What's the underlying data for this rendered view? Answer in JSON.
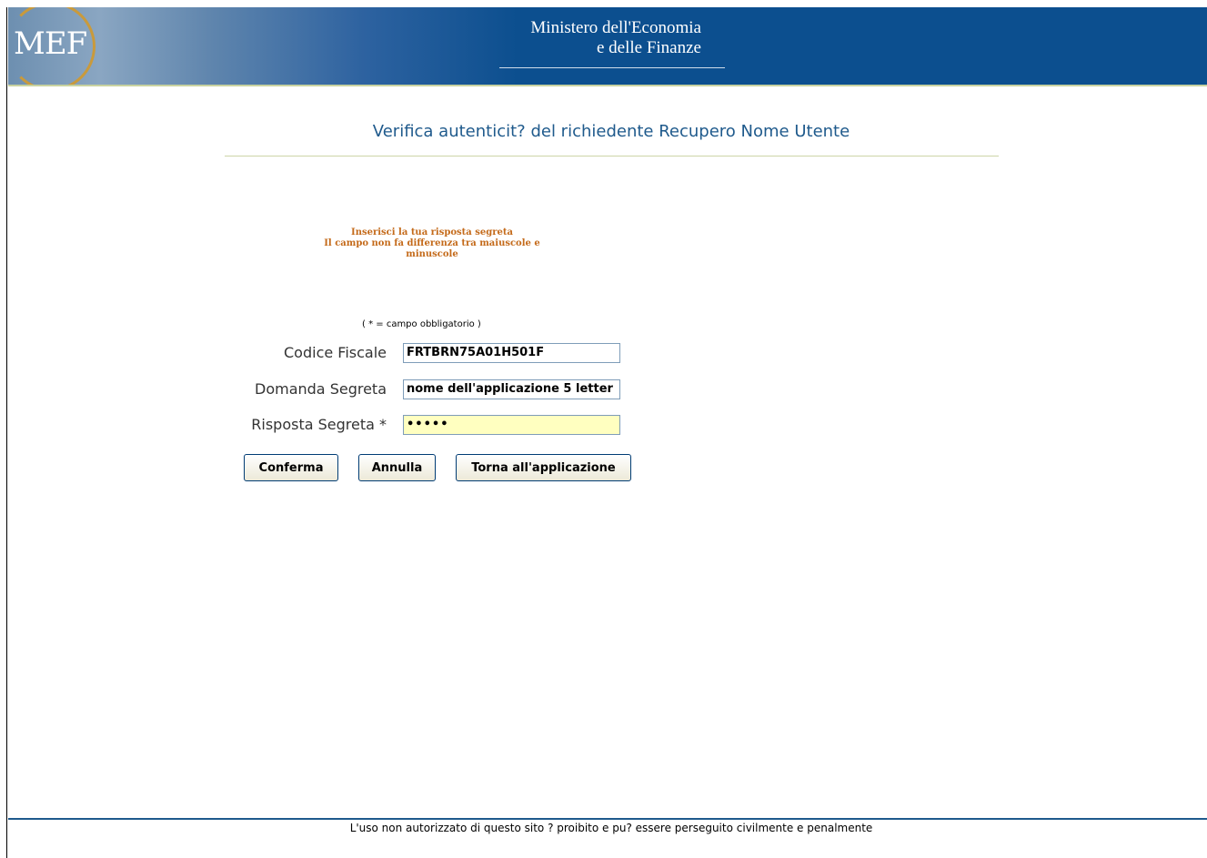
{
  "header": {
    "logo_text": "MEF",
    "ministry_line1": "Ministero dell'Economia",
    "ministry_line2": "e delle Finanze"
  },
  "page": {
    "title": "Verifica autenticit? del richiedente Recupero Nome Utente"
  },
  "instructions": {
    "line1": "Inserisci la tua risposta segreta",
    "line2": "Il campo non fa differenza tra maiuscole e",
    "line3": "minuscole"
  },
  "form": {
    "required_note": "( * = campo obbligatorio )",
    "codice_fiscale": {
      "label": "Codice Fiscale",
      "value": "FRTBRN75A01H501F"
    },
    "domanda_segreta": {
      "label": "Domanda Segreta",
      "value": "nome dell'applicazione 5 letter"
    },
    "risposta_segreta": {
      "label": "Risposta Segreta *",
      "value": "•••••"
    }
  },
  "buttons": {
    "confirm": "Conferma",
    "cancel": "Annulla",
    "back": "Torna all'applicazione"
  },
  "footer": {
    "text": "L'uso non autorizzato di questo sito ? proibito e pu? essere perseguito civilmente e penalmente"
  },
  "colors": {
    "header_blue": "#0c4f8f",
    "title_blue": "#1f5a8c",
    "instruction_orange": "#c46a1a",
    "input_highlight": "#ffffc0"
  }
}
